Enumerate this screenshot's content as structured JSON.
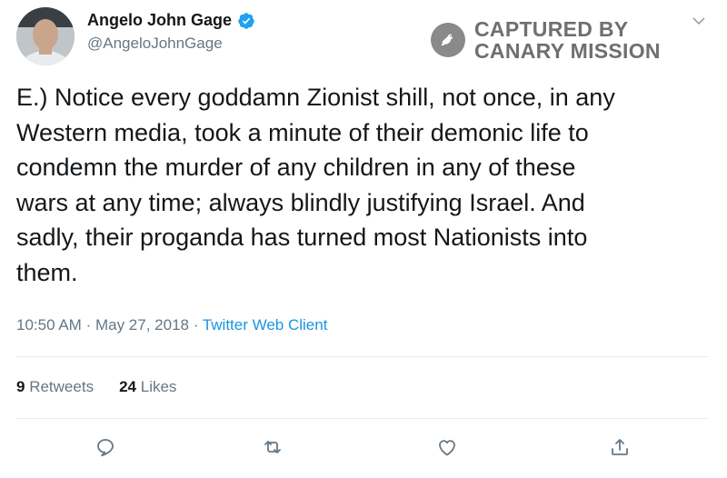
{
  "tweet": {
    "author": {
      "display_name": "Angelo John Gage",
      "handle": "@AngeloJohnGage",
      "verified": true
    },
    "text": "E.) Notice every goddamn Zionist shill, not once, in any\nWestern media, took a minute of their demonic life to\ncondemn the murder of any children in any of these\nwars at any time; always blindly justifying Israel. And\nsadly, their proganda has turned most Nationists into\nthem.",
    "time": "10:50 AM",
    "date": "May 27, 2018",
    "source": "Twitter Web Client",
    "separator": "·",
    "retweets_count": "9",
    "retweets_label": "Retweets",
    "likes_count": "24",
    "likes_label": "Likes"
  },
  "watermark": {
    "line1": "CAPTURED BY",
    "line2": "CANARY MISSION"
  },
  "icons": {
    "verified": "verified-badge-icon",
    "caret": "chevron-down-icon",
    "reply": "reply-icon",
    "retweet": "retweet-icon",
    "like": "like-heart-icon",
    "share": "share-icon"
  },
  "colors": {
    "verified_blue": "#1da1f2",
    "link_blue": "#1b95e0",
    "secondary_text": "#657786",
    "watermark_gray": "#6f6f6f"
  }
}
